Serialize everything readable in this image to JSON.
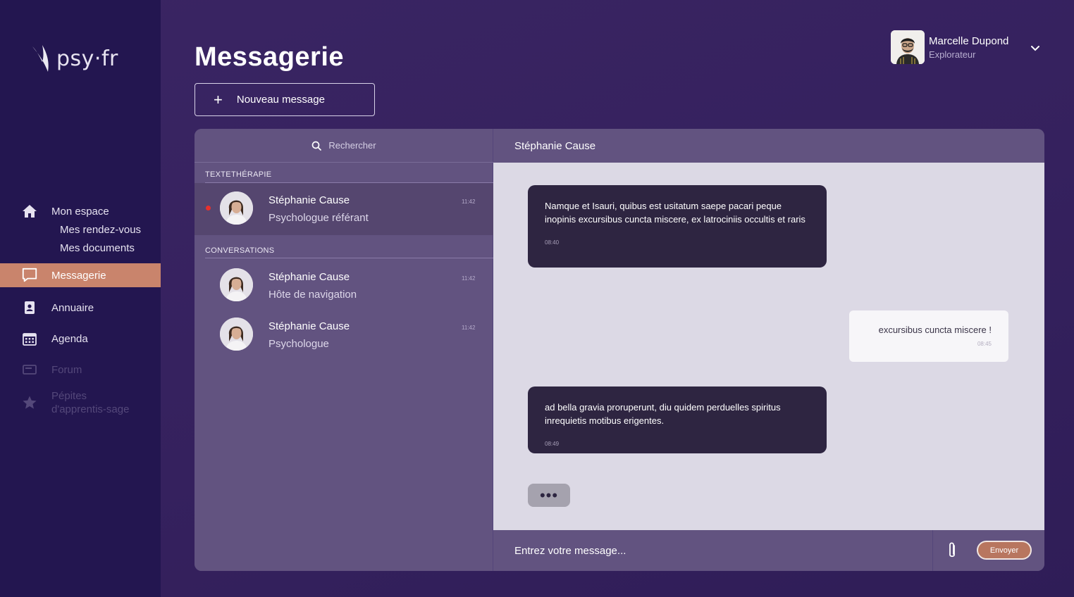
{
  "brand": {
    "logo_text": "psy·fr"
  },
  "sidebar": {
    "items": [
      {
        "label": "Mon espace",
        "icon": "home-icon"
      },
      {
        "label": "Mes rendez-vous"
      },
      {
        "label": "Mes documents"
      },
      {
        "label": "Messagerie",
        "icon": "chat-bubble-icon",
        "active": true
      },
      {
        "label": "Annuaire",
        "icon": "contact-book-icon"
      },
      {
        "label": "Agenda",
        "icon": "calendar-icon"
      },
      {
        "label": "Forum",
        "icon": "forum-icon",
        "disabled": true
      },
      {
        "label_line1": "Pépites",
        "label_line2": "d'apprentis-sage",
        "icon": "star-icon",
        "disabled": true
      }
    ]
  },
  "header": {
    "title": "Messagerie",
    "new_message_label": "Nouveau message"
  },
  "user": {
    "name": "Marcelle Dupond",
    "role": "Explorateur"
  },
  "conversations": {
    "search_placeholder": "Rechercher",
    "section_textetherapie": "TEXTETHÉRAPIE",
    "section_conversations": "CONVERSATIONS",
    "items": [
      {
        "name": "Stéphanie Cause",
        "role": "Psychologue référant",
        "time": "11:42",
        "unread": true
      },
      {
        "name": "Stéphanie Cause",
        "role": "Hôte de navigation",
        "time": "11:42"
      },
      {
        "name": "Stéphanie Cause",
        "role": "Psychologue",
        "time": "11:42"
      }
    ]
  },
  "chat": {
    "contact_name": "Stéphanie Cause",
    "messages": [
      {
        "from": "them",
        "text": "Namque et Isauri, quibus est usitatum saepe pacari peque inopinis excursibus cuncta miscere, ex latrociniis occultis et raris",
        "time": "08:40"
      },
      {
        "from": "me",
        "text": "excursibus cuncta miscere !",
        "time": "08:45"
      },
      {
        "from": "them",
        "text": "ad bella gravia proruperunt, diu quidem perduelles spiritus inrequietis motibus erigentes.",
        "time": "08:49"
      }
    ],
    "typing_indicator": "•••",
    "input_placeholder": "Entrez votre message...",
    "send_label": "Envoyer"
  },
  "colors": {
    "background": "#35215e",
    "sidebar": "#231650",
    "accent": "#c9846c",
    "panel": "#625380",
    "chat_area": "#dcd9e5",
    "bubble_dark": "#2e2541",
    "unread_dot": "#e8302c"
  }
}
